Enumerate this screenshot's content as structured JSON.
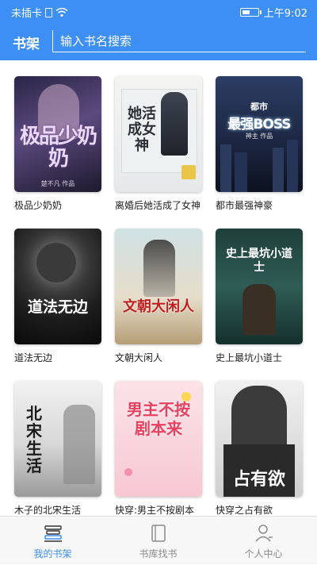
{
  "status_bar": {
    "carrier": "未插卡",
    "time": "上午9:02",
    "battery_level": 0.55
  },
  "header": {
    "title": "书架",
    "search_placeholder": "输入书名搜索"
  },
  "books": [
    {
      "name": "极品少奶奶",
      "cover_title": "极品少奶奶",
      "cover_author": "楚不凡 作品"
    },
    {
      "name": "离婚后她活成了女神",
      "cover_title": "她活成女神"
    },
    {
      "name": "都市最强神豪",
      "cover_title": "最强BOSS",
      "cover_badge": "都市",
      "cover_author": "神主 作品"
    },
    {
      "name": "道法无边",
      "cover_title": "道法无边"
    },
    {
      "name": "文朝大闲人",
      "cover_title": "文朝大闲人"
    },
    {
      "name": "史上最坑小道士",
      "cover_title": "史上最坑小道士"
    },
    {
      "name": "木子的北宋生活",
      "cover_title": "北宋生活"
    },
    {
      "name": "快穿:男主不按剧本",
      "cover_title": "男主不按剧本来"
    },
    {
      "name": "快穿之占有欲",
      "cover_title": "占有欲"
    }
  ],
  "bottom_nav": [
    {
      "label": "我的书架",
      "active": true
    },
    {
      "label": "书库找书",
      "active": false
    },
    {
      "label": "个人中心",
      "active": false
    }
  ],
  "colors": {
    "accent": "#3d8ff5",
    "inactive": "#8a8a8a"
  }
}
